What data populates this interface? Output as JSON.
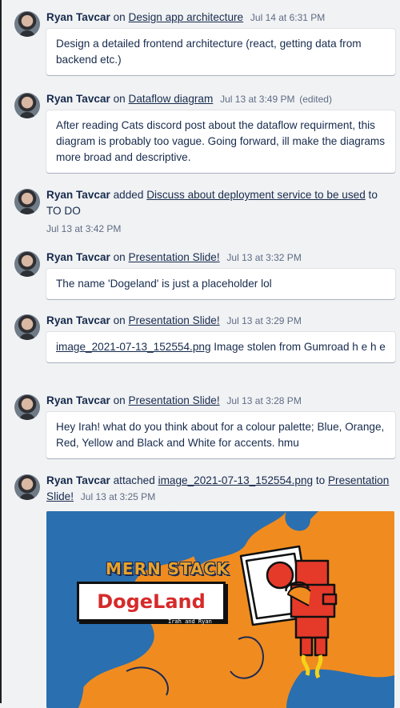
{
  "activity": [
    {
      "author": "Ryan Tavcar",
      "connector": "on",
      "card": "Design app architecture",
      "time": "Jul 14 at 6:31 PM",
      "comment": "Design a detailed frontend architecture (react, getting data from backend etc.)"
    },
    {
      "author": "Ryan Tavcar",
      "connector": "on",
      "card": "Dataflow diagram",
      "time": "Jul 13 at 3:49 PM",
      "edited": "(edited)",
      "comment": "After reading Cats discord post about the dataflow requirment, this diagram is probably too vague. Going forward, ill make the diagrams more broad and descriptive."
    },
    {
      "author": "Ryan Tavcar",
      "connector": "added",
      "card": "Discuss about deployment service to be used",
      "to_text": "to",
      "list": "TO DO",
      "time": "Jul 13 at 3:42 PM"
    },
    {
      "author": "Ryan Tavcar",
      "connector": "on",
      "card": "Presentation Slide!",
      "time": "Jul 13 at 3:32 PM",
      "comment": "The name 'Dogeland' is just a placeholder lol"
    },
    {
      "author": "Ryan Tavcar",
      "connector": "on",
      "card": "Presentation Slide!",
      "time": "Jul 13 at 3:29 PM",
      "comment_link": "image_2021-07-13_152554.png",
      "comment": "Image stolen from Gumroad h e h e"
    },
    {
      "author": "Ryan Tavcar",
      "connector": "on",
      "card": "Presentation Slide!",
      "time": "Jul 13 at 3:28 PM",
      "comment": "Hey Irah! what do you think about for a colour palette; Blue, Orange, Red, Yellow and Black and White for accents. hmu"
    },
    {
      "author": "Ryan Tavcar",
      "connector": "attached",
      "attachment": "image_2021-07-13_152554.png",
      "to_text": "to",
      "card": "Presentation Slide!",
      "time": "Jul 13 at 3:25 PM",
      "thumbnail": {
        "heading": "MERN STACK",
        "title": "DogeLand",
        "byline": "Irah and Ryan"
      }
    }
  ],
  "colors": {
    "background": "#f1f2f4",
    "thumb_orange": "#f08c1f",
    "thumb_blue": "#2a6fb0",
    "thumb_red": "#e53a2a"
  }
}
